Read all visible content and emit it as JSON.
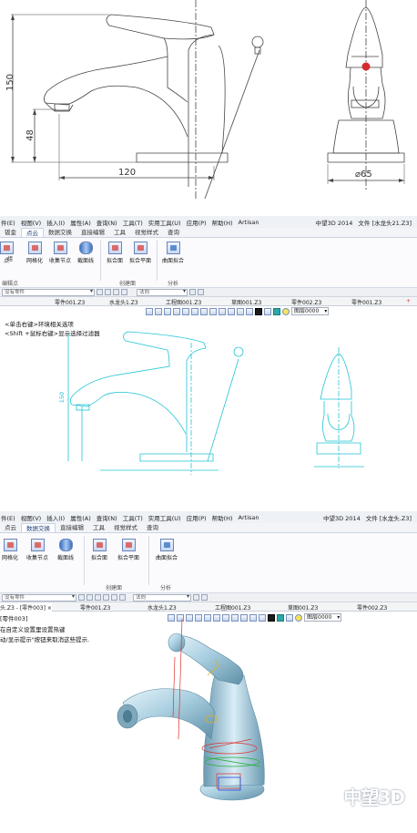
{
  "drawing": {
    "dims": {
      "height_150": "150",
      "height_48": "48",
      "width_120": "120",
      "diameter_65": "⌀65"
    }
  },
  "window1": {
    "menu": [
      "件(E)",
      "视图(V)",
      "插入(I)",
      "属性(A)",
      "查询(N)",
      "工具(T)",
      "实用工具(U)",
      "应用(P)",
      "帮助(H)",
      "Artisan"
    ],
    "app_title": "中望3D 2014",
    "file_label": "文件 [水龙头21.Z3]",
    "tabs": [
      "钣金",
      "点云",
      "数据交换",
      "直接编辑",
      "工具",
      "视觉样式",
      "查询"
    ],
    "active_tab": "点云",
    "ribbon": {
      "buttons": [
        "网格化",
        "收集节点",
        "截面线",
        "拟合面",
        "拟合平面",
        "曲面拟合"
      ],
      "group_point": "编辑点",
      "group_create": "创建面",
      "group_analysis": "分析",
      "partial_labels": [
        "点",
        "组"
      ]
    },
    "filter": {
      "combo1": "没有零件",
      "combo2": "法向"
    },
    "doctabs": [
      "零件001.Z3",
      "水龙头1.Z3",
      "工程图001.Z3",
      "草图001.Z3",
      "零件002.Z3",
      "零件001.Z3"
    ],
    "hints": [
      "<单击右键>环境相关选项",
      "<Shift +鼠标右键>显示选择过滤器"
    ],
    "layer": "图层0000",
    "drawing_label_150": "150"
  },
  "window2": {
    "menu": [
      "件(E)",
      "视图(V)",
      "插入(I)",
      "属性(A)",
      "查询(N)",
      "工具(T)",
      "实用工具(U)",
      "应用(P)",
      "帮助(H)",
      "Artisan"
    ],
    "app_title": "中望3D 2014",
    "file_label": "文件 [水龙头.Z3]",
    "tabs": [
      "点云",
      "数据交换",
      "直接编辑",
      "工具",
      "视觉样式",
      "查询"
    ],
    "active_tab": "数据交换",
    "ribbon": {
      "buttons": [
        "网格化",
        "收集节点",
        "截面线",
        "拟合面",
        "拟合平面",
        "曲面拟合"
      ],
      "group_create": "创建面",
      "group_analysis": "分析"
    },
    "filter": {
      "combo1": "没有零件",
      "combo2": "法向"
    },
    "doctabs": [
      "头.Z3 - [零件003] ×",
      "零件001.Z3",
      "水龙头1.Z3",
      "工程图001.Z3",
      "草图001.Z3",
      "零件002.Z3"
    ],
    "hints": [
      "[零件003]",
      "在自定义设置里设置热键",
      "动/显示提示\"按钮来取消这些提示."
    ],
    "layer": "图层0000"
  },
  "watermark": "中望3D"
}
